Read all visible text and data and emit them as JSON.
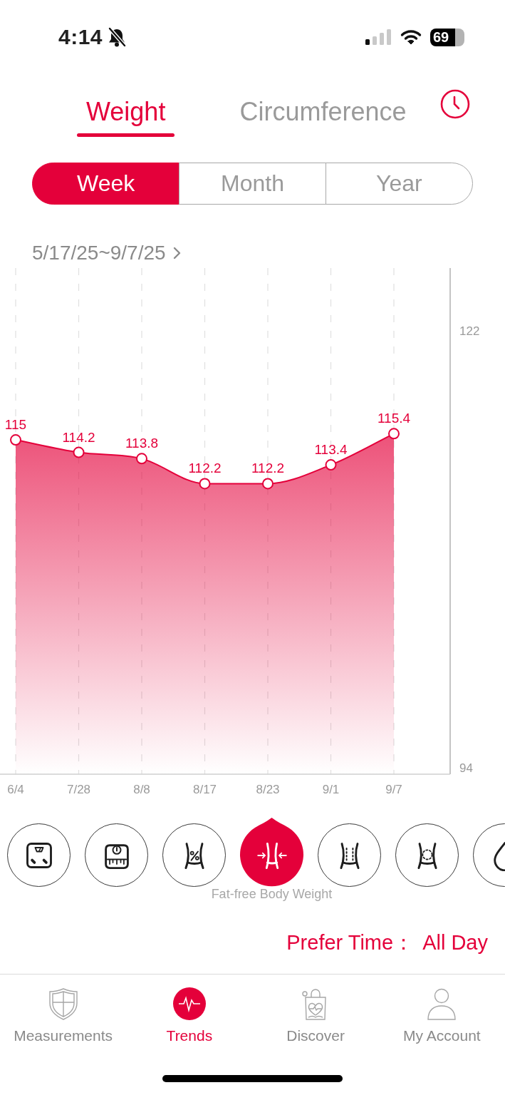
{
  "status_bar": {
    "time": "4:14",
    "battery": "69"
  },
  "tabs": [
    {
      "label": "Weight",
      "selected": true
    },
    {
      "label": "Circumference",
      "selected": false
    }
  ],
  "periods": [
    {
      "label": "Week",
      "selected": true
    },
    {
      "label": "Month",
      "selected": false
    },
    {
      "label": "Year",
      "selected": false
    }
  ],
  "date_range": "5/17/25~9/7/25",
  "chart": {
    "chart_data": {
      "type": "area",
      "categories": [
        "6/4",
        "7/28",
        "8/8",
        "8/17",
        "8/23",
        "9/1",
        "9/7"
      ],
      "series": [
        {
          "color": "#e4003a",
          "values": [
            115,
            114.2,
            113.8,
            112.2,
            112.2,
            113.4,
            115.4
          ]
        }
      ],
      "ylim": [
        93.6,
        126
      ],
      "yticks": [
        94,
        122
      ],
      "grid": true,
      "data_labels": true
    }
  },
  "metrics": [
    {
      "kind": "scale",
      "selected": false
    },
    {
      "kind": "dial",
      "selected": false
    },
    {
      "kind": "percent",
      "selected": false
    },
    {
      "kind": "arrows",
      "selected": true
    },
    {
      "kind": "dots",
      "selected": false
    },
    {
      "kind": "ring",
      "selected": false
    },
    {
      "kind": "drop",
      "selected": false
    }
  ],
  "metric_caption": "Fat-free Body Weight",
  "prefer_time": {
    "label": "Prefer Time：",
    "value": "All Day"
  },
  "nav": [
    {
      "label": "Measurements",
      "kind": "shield",
      "selected": false
    },
    {
      "label": "Trends",
      "kind": "pulse",
      "selected": true
    },
    {
      "label": "Discover",
      "kind": "bag",
      "selected": false
    },
    {
      "label": "My Account",
      "kind": "person",
      "selected": false
    }
  ]
}
